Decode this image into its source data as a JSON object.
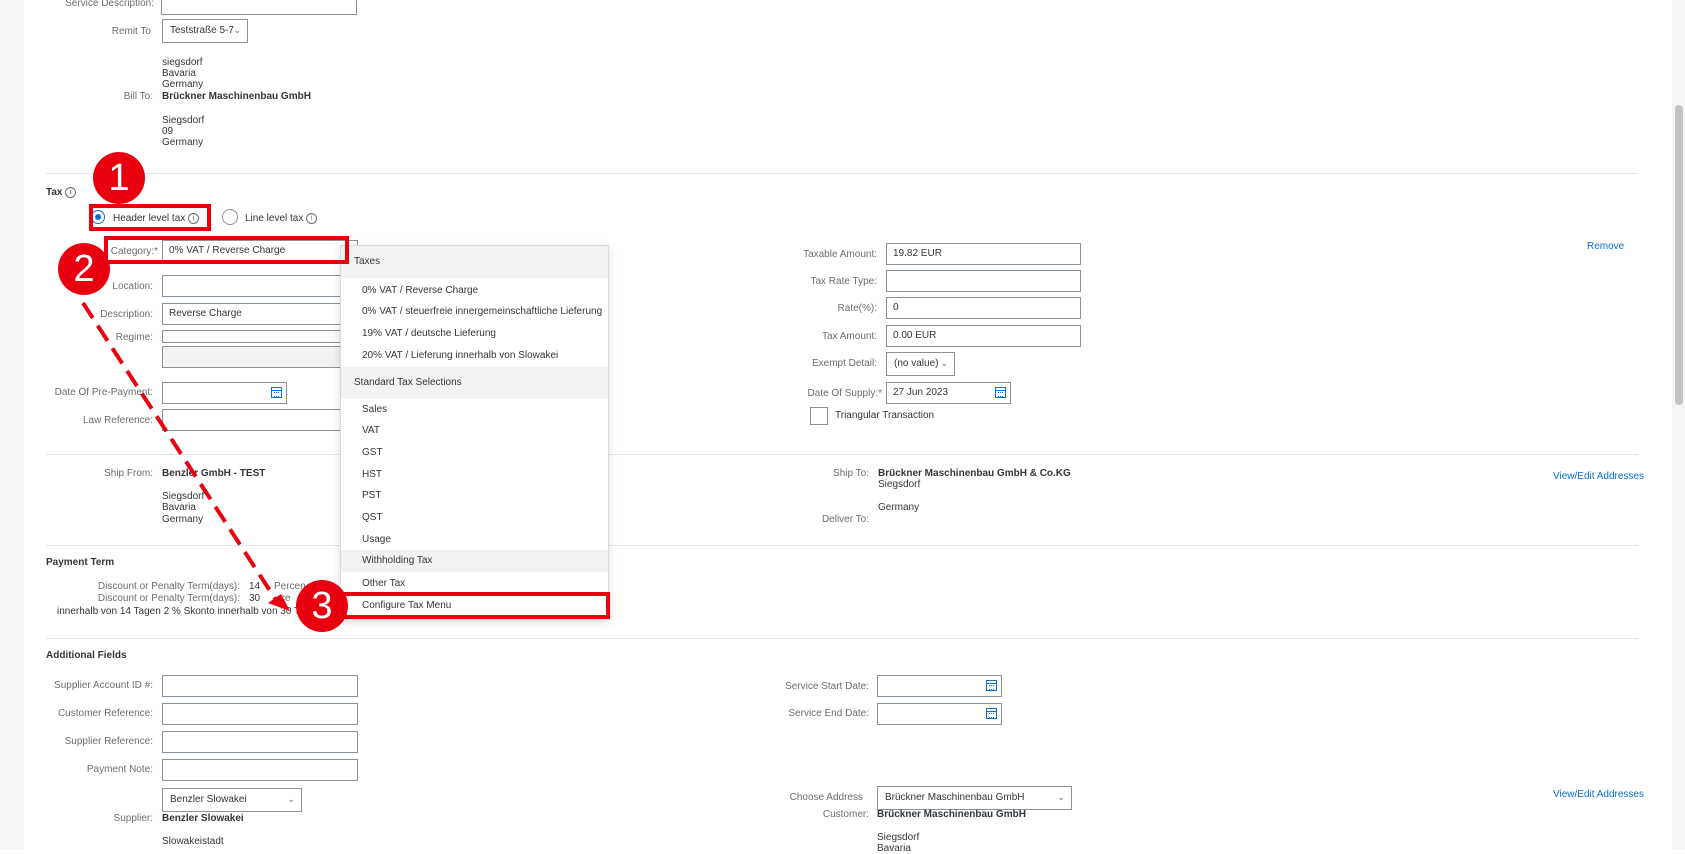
{
  "top": {
    "service_description_label": "Service Description:",
    "remit_to_label": "Remit To",
    "remit_to_value": "Teststraße 5-7",
    "remit_lines": [
      "siegsdorf",
      "Bavaria",
      "Germany"
    ],
    "bill_to_label": "Bill To:",
    "bill_to_name": "Brückner Maschinenbau GmbH",
    "bill_to_lines": [
      "Siegsdorf",
      "09",
      "Germany"
    ]
  },
  "tax": {
    "title": "Tax",
    "header_level": "Header level tax",
    "line_level": "Line level tax",
    "category_label": "Category:*",
    "category_value": "0% VAT / Reverse Charge",
    "location_label": "Location:",
    "description_label": "Description:",
    "description_value": "Reverse Charge",
    "regime_label": "Regime:",
    "prepayment_label": "Date Of Pre-Payment:",
    "law_label": "Law Reference:",
    "taxable_label": "Taxable Amount:",
    "taxable_value": "19.82 EUR",
    "rate_type_label": "Tax Rate Type:",
    "rate_label": "Rate(%):",
    "rate_value": "0",
    "tax_amount_label": "Tax Amount:",
    "tax_amount_value": "0.00 EUR",
    "exempt_label": "Exempt Detail:",
    "exempt_value": "(no value)",
    "supply_label": "Date Of Supply:*",
    "supply_value": "27 Jun 2023",
    "triangular_label": "Triangular Transaction",
    "remove": "Remove"
  },
  "menu": {
    "group_taxes": "Taxes",
    "taxes": [
      "0% VAT / Reverse Charge",
      "0% VAT / steuerfreie innergemeinschaftliche Lieferung",
      "19% VAT / deutsche Lieferung",
      "20% VAT / Lieferung innerhalb von Slowakei"
    ],
    "group_standard": "Standard Tax Selections",
    "standard": [
      "Sales",
      "VAT",
      "GST",
      "HST",
      "PST",
      "QST",
      "Usage",
      "Withholding Tax",
      "Other Tax"
    ],
    "configure": "Configure Tax Menu"
  },
  "ship": {
    "ship_from_label": "Ship From:",
    "ship_from_name": "Benzler GmbH - TEST",
    "ship_from_lines": [
      "Siegsdorf",
      "Bavaria",
      "Germany"
    ],
    "ship_to_label": "Ship To:",
    "ship_to_name": "Brückner Maschinenbau GmbH & Co.KG",
    "ship_to_city": "Siegsdorf",
    "ship_to_country": "Germany",
    "deliver_to_label": "Deliver To:",
    "view_edit": "View/Edit Addresses"
  },
  "payment": {
    "title": "Payment Term",
    "row1_label": "Discount or Penalty Term(days):",
    "row1_days": "14",
    "row2_label": "Discount or Penalty Term(days):",
    "row2_days": "30",
    "percent_frag": "Percen",
    "percent_frag2": "ce",
    "note": "innerhalb von 14 Tagen 2 % Skonto innerhalb von 30 Tag"
  },
  "additional": {
    "title": "Additional Fields",
    "supplier_account_label": "Supplier Account ID #:",
    "customer_ref_label": "Customer Reference:",
    "supplier_ref_label": "Supplier Reference:",
    "payment_note_label": "Payment Note:",
    "supplier_select": "Benzler Slowakei",
    "supplier_label": "Supplier:",
    "supplier_name": "Benzler Slowakei",
    "supplier_city": "Slowakeistadt",
    "service_start_label": "Service Start Date:",
    "service_end_label": "Service End Date:",
    "choose_address_label": "Choose Address",
    "choose_address_value": "Brückner Maschinenbau GmbH",
    "customer_label": "Customer:",
    "customer_name": "Brückner Maschinenbau GmbH",
    "customer_lines": [
      "Siegsdorf",
      "Bavaria"
    ],
    "view_edit": "View/Edit Addresses"
  },
  "annotations": {
    "n1": "1",
    "n2": "2",
    "n3": "3",
    "color": "#e8000f"
  }
}
